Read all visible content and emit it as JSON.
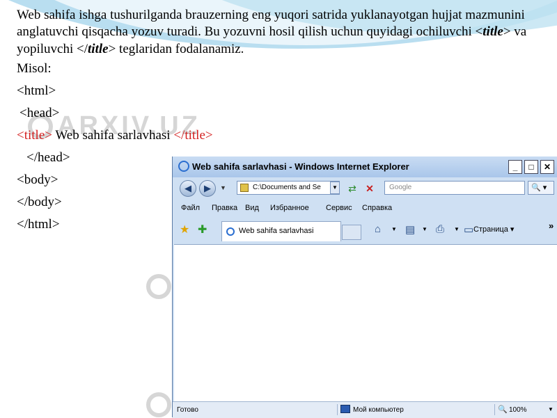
{
  "slide": {
    "paragraph": {
      "text_before": "Web sahifa ishga tushurilganda brauzerning eng yuqori satrida yuklanayotgan hujjat mazmunini anglatuvchi qisqacha yozuv turadi. Bu yozuvni hosil qilish uchun quyidagi ochiluvchi <",
      "tag_open": "title",
      "text_middle": "> va yopiluvchi </",
      "tag_close": "title",
      "text_after": "> teglaridan fodalanamiz."
    },
    "example_label": "Misol:",
    "code_lines": [
      "<html>",
      " <head>",
      "",
      "   </head>",
      "<body>",
      "</body>",
      "</html>"
    ],
    "title_line": {
      "open_tag": "<title>",
      "text": " Web sahifa  sarlavhasi ",
      "close_tag": "</title>"
    },
    "watermark": "ARXIV.UZ"
  },
  "browser": {
    "window_title": "Web sahifa sarlavhasi - Windows Internet Explorer",
    "address_value": "C:\\Documents and Se",
    "search_placeholder": "Google",
    "search_button": "🔍 ▾",
    "menu": [
      "Файл",
      "Правка",
      "Вид",
      "Избранное",
      "Сервис",
      "Справка"
    ],
    "tab_label": "Web sahifa sarlavhasi",
    "page_button": "Страница ▾",
    "status_text": "Готово",
    "zone_text": "Мой компьютер",
    "zoom": "100%"
  },
  "colors": {
    "tag_red": "#d42020",
    "ie_frame": "#cfe0f3"
  }
}
